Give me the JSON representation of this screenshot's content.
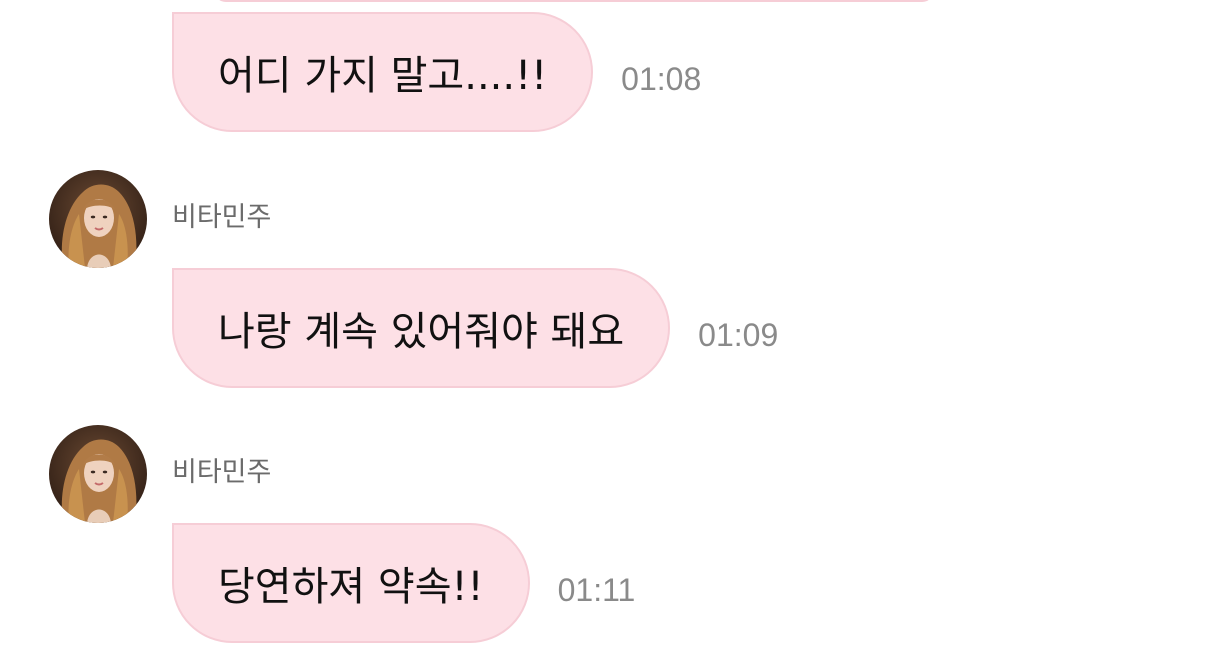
{
  "chat": {
    "messages": [
      {
        "sender": "",
        "text": "어디 가지 말고....!!",
        "time": "01:08"
      },
      {
        "sender": "비타민주",
        "avatar": "profile-photo",
        "text": "나랑 계속 있어줘야 돼요",
        "time": "01:09"
      },
      {
        "sender": "비타민주",
        "avatar": "profile-photo",
        "text": "당연하져 약속!!",
        "time": "01:11"
      }
    ]
  },
  "colors": {
    "bubble_fill": "#fde0e6",
    "bubble_border": "#f6cdd6",
    "sender_text": "#6b6b6b",
    "time_text": "#8a8a8a",
    "message_text": "#111111"
  }
}
